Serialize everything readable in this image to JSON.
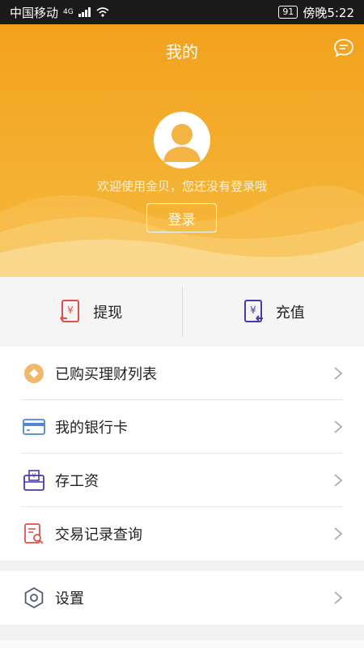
{
  "status": {
    "carrier": "中国移动",
    "network": "4G",
    "battery": "91",
    "time": "傍晚5:22"
  },
  "header": {
    "title": "我的"
  },
  "profile": {
    "welcome": "欢迎使用金贝，您还没有登录哦",
    "login_label": "登录"
  },
  "actions": [
    {
      "label": "提现"
    },
    {
      "label": "充值"
    }
  ],
  "menu": [
    {
      "label": "已购买理财列表"
    },
    {
      "label": "我的银行卡"
    },
    {
      "label": "存工资"
    },
    {
      "label": "交易记录查询"
    }
  ],
  "settings": {
    "label": "设置"
  },
  "colors": {
    "accent": "#f2a21d",
    "red_icon": "#e0504a",
    "purple_icon": "#4a3aa8",
    "blue_icon": "#4f86d8"
  }
}
